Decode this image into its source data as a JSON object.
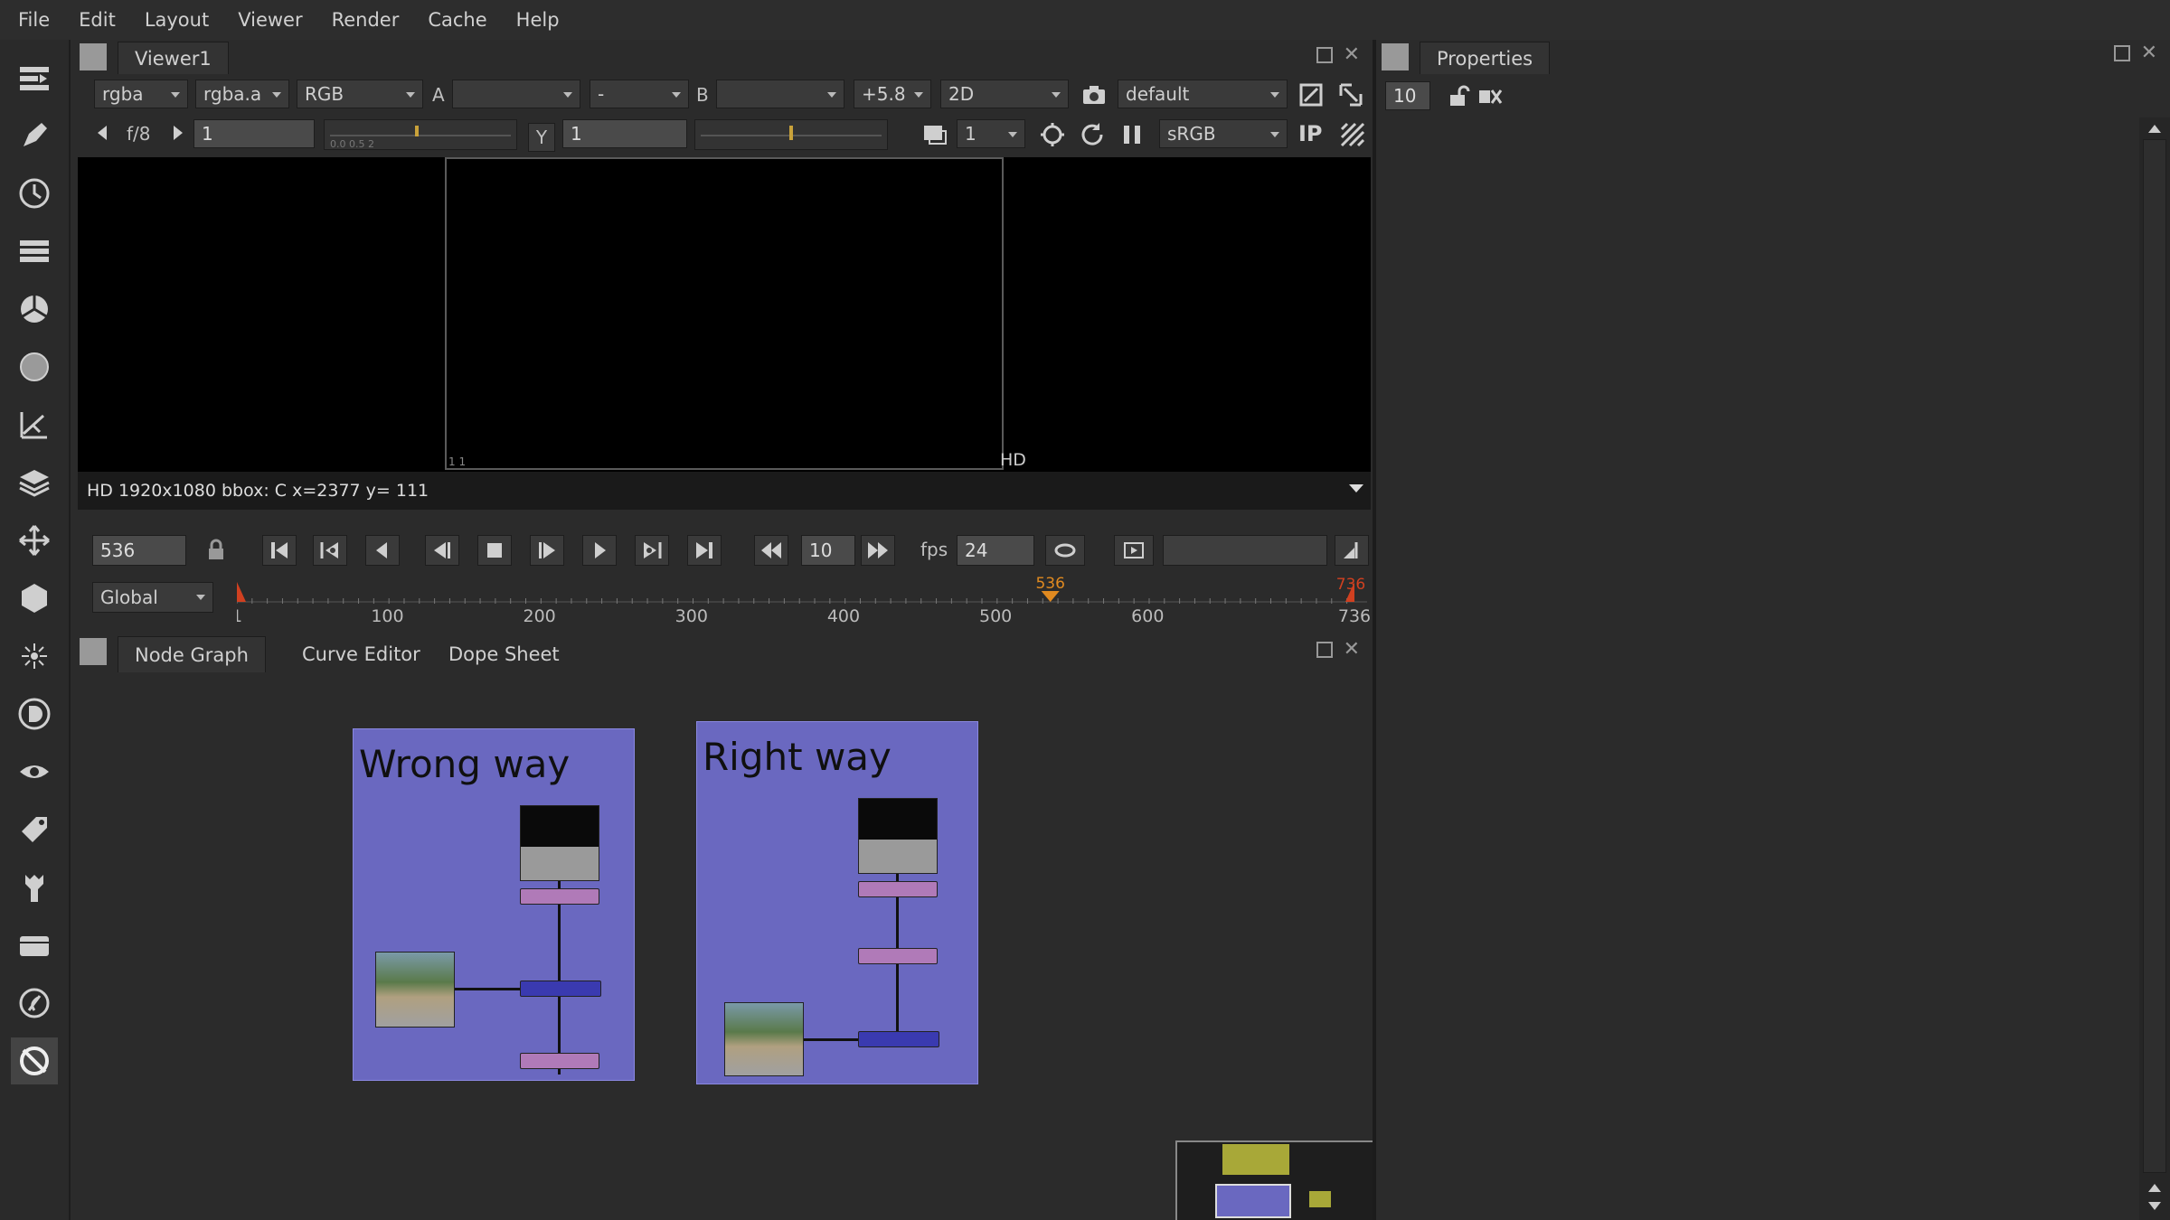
{
  "menu": [
    "File",
    "Edit",
    "Layout",
    "Viewer",
    "Render",
    "Cache",
    "Help"
  ],
  "viewer": {
    "tab": "Viewer1",
    "row1": {
      "channels": "rgba",
      "alpha": "rgba.a",
      "colorspace_in": "RGB",
      "a_label": "A",
      "a_input": "",
      "a_op": "-",
      "b_label": "B",
      "b_input": "",
      "gain": "+5.8",
      "view_mode": "2D",
      "lut": "default"
    },
    "row2": {
      "fstop": "f/8",
      "gain_value": "1",
      "gain_ticks": "0.0 0.5 2",
      "gamma_label": "Y",
      "gamma_value": "1",
      "proxy": "1",
      "display": "sRGB",
      "ip": "IP"
    },
    "format_label": "HD",
    "corner_label": "1 1",
    "status": "HD 1920x1080 bbox: C  x=2377 y= 111"
  },
  "transport": {
    "frame": "536",
    "step": "10",
    "fps_label": "fps",
    "fps": "24"
  },
  "timeline": {
    "range_mode": "Global",
    "start": "1",
    "end": "736",
    "current": "536",
    "ticks": [
      "1",
      "100",
      "200",
      "300",
      "400",
      "500",
      "600",
      "736"
    ]
  },
  "node_panel": {
    "tabs": [
      "Node Graph",
      "Curve Editor",
      "Dope Sheet"
    ],
    "backdrops": [
      {
        "title": "Wrong way"
      },
      {
        "title": "Right way"
      }
    ]
  },
  "properties": {
    "tab": "Properties",
    "max_panels": "10"
  },
  "colors": {
    "backdrop": "#6a68c0",
    "node_pink": "#b07ab8",
    "node_blue": "#3a3ab0",
    "playhead": "#e08a20",
    "minimap_node": "#a8a838"
  }
}
